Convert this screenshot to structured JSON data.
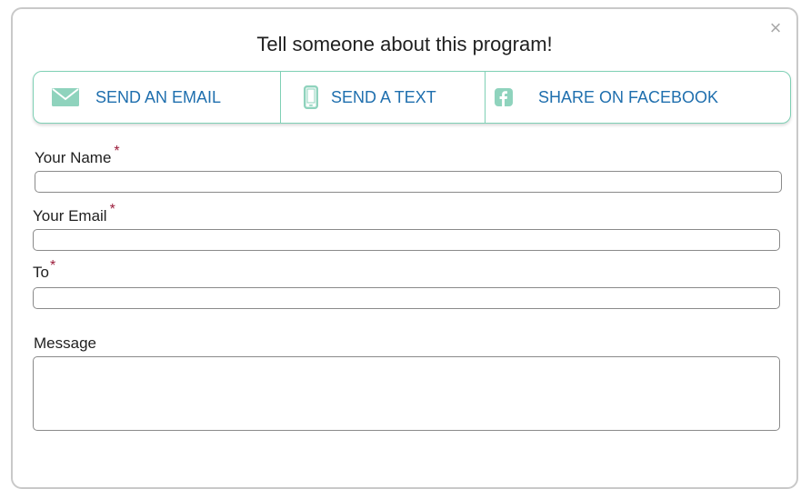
{
  "dialog": {
    "title": "Tell someone about this program!",
    "close_glyph": "×"
  },
  "share": {
    "email": {
      "label": "SEND AN EMAIL",
      "icon": "envelope-icon"
    },
    "text": {
      "label": "SEND A TEXT",
      "icon": "mobile-phone-icon"
    },
    "facebook": {
      "label": "SHARE ON FACEBOOK",
      "icon": "facebook-icon"
    }
  },
  "form": {
    "name_label": "Your Name",
    "email_label": "Your Email",
    "to_label": "To",
    "message_label": "Message",
    "required_marker": "*",
    "name_value": "",
    "email_value": "",
    "to_value": "",
    "message_value": ""
  },
  "colors": {
    "accent": "#7fd0b5",
    "link_text": "#1f6fae",
    "required": "#9b1b3a"
  }
}
